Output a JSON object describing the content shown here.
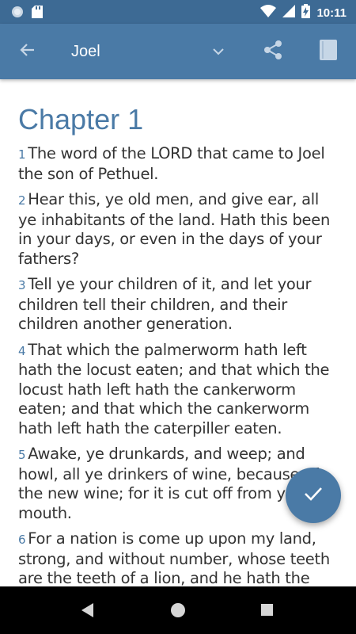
{
  "status_bar": {
    "time": "10:11",
    "icons": [
      "circle-notification-icon",
      "sd-card-icon",
      "wifi-icon",
      "signal-icon",
      "battery-charging-icon"
    ]
  },
  "toolbar": {
    "title": "Joel",
    "icons": [
      "back-arrow-icon",
      "chevron-down-icon",
      "share-icon",
      "book-icon"
    ]
  },
  "chapter": {
    "title": "Chapter 1",
    "verses": [
      {
        "num": "1",
        "text": "The word of the LORD that came to Joel the son of Pethuel."
      },
      {
        "num": "2",
        "text": "Hear this, ye old men, and give ear, all ye inhabitants of the land. Hath this been in your days, or even in the days of your fathers?"
      },
      {
        "num": "3",
        "text": "Tell ye your children of it, and let your children tell their children, and their children another generation."
      },
      {
        "num": "4",
        "text": "That which the palmerworm hath left hath the locust eaten; and that which the locust hath left hath the cankerworm eaten; and that which the cankerworm hath left hath the caterpiller eaten."
      },
      {
        "num": "5",
        "text": "Awake, ye drunkards, and weep; and howl, all ye drinkers of wine, because of the new wine; for it is cut off from your mouth."
      },
      {
        "num": "6",
        "text": "For a nation is come up upon my land, strong, and without number, whose teeth are the teeth of a lion, and he hath the cheek teeth of a great lion."
      }
    ]
  },
  "fab": {
    "icon": "check-icon"
  },
  "colors": {
    "accent": "#4a7aa6",
    "status_bar": "#3d6a94",
    "text": "#333333"
  }
}
